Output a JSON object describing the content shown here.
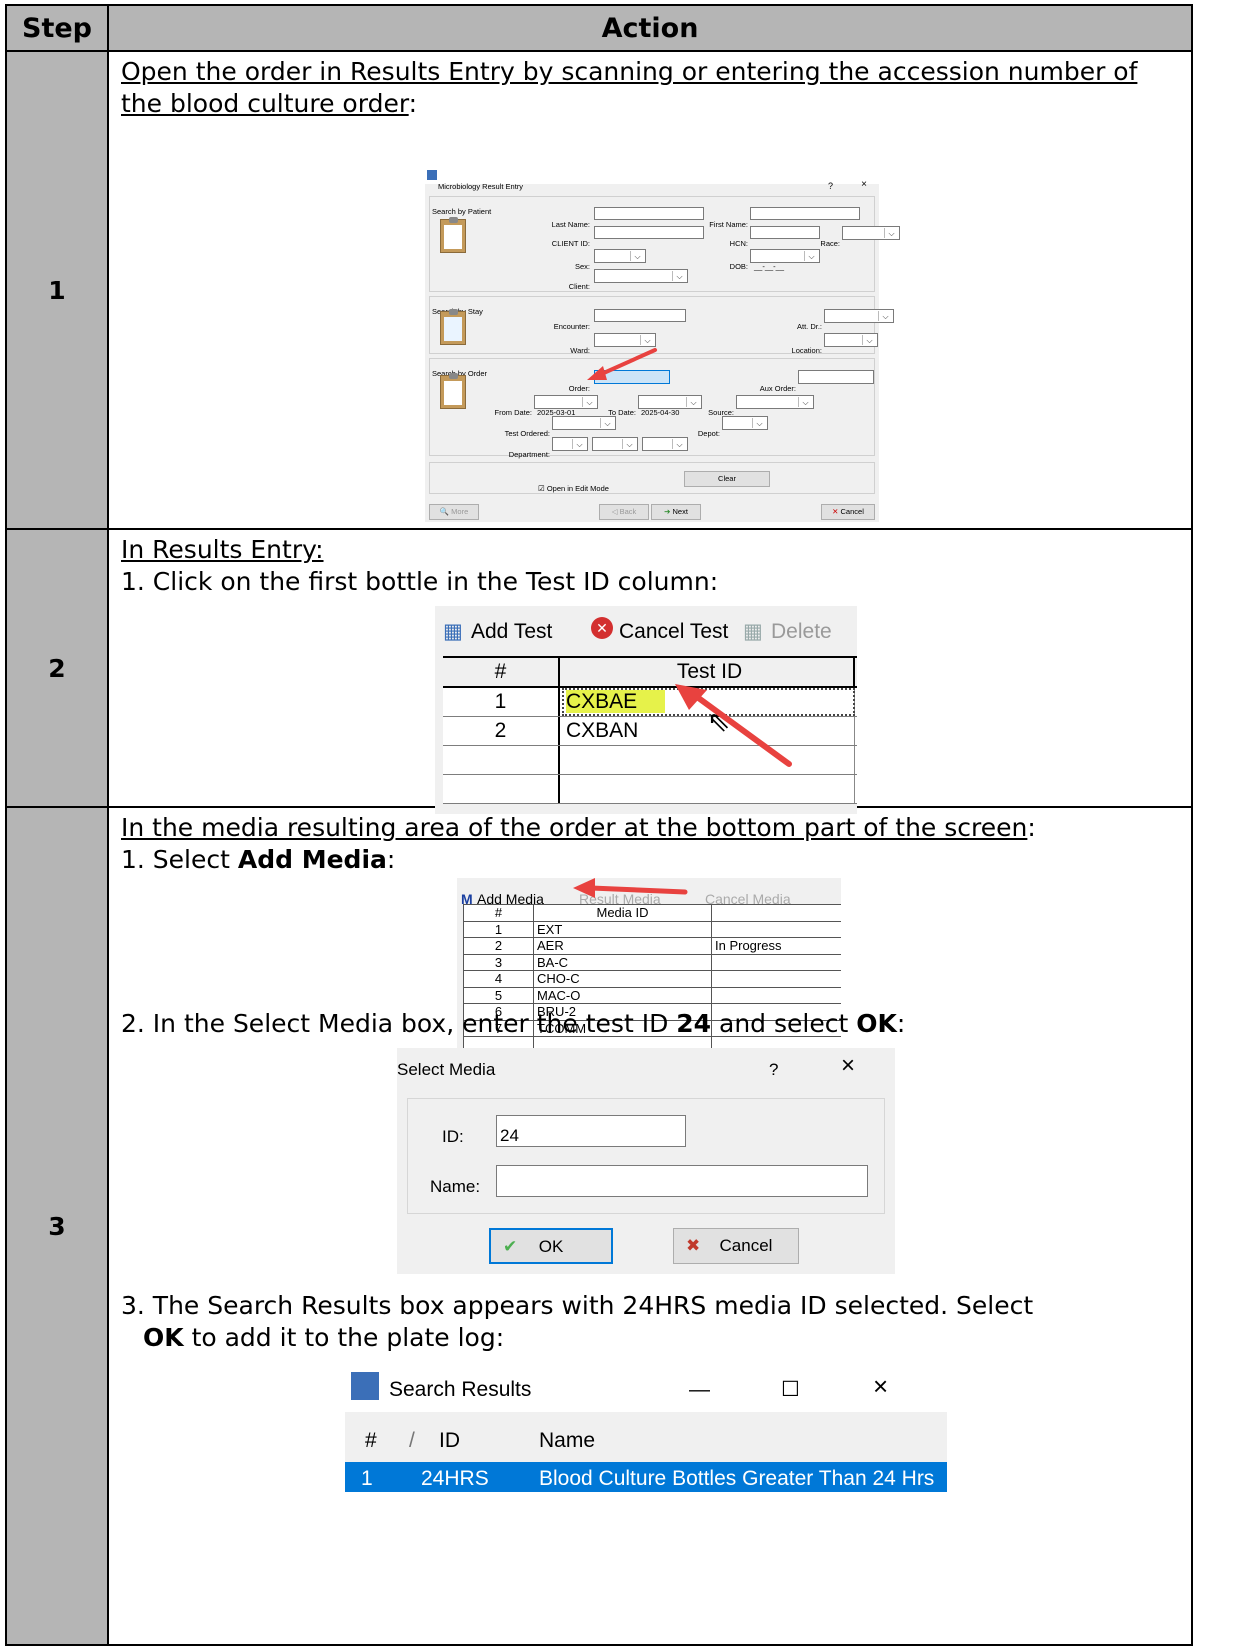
{
  "table": {
    "header_step": "Step",
    "header_action": "Action"
  },
  "step1": {
    "number": "1",
    "instruction": "Open the order in Results Entry by scanning or entering the accession number of the blood culture order",
    "instruction_suffix": ":",
    "dialog": {
      "title": "Microbiology Result Entry",
      "help": "?",
      "close": "×",
      "group_patient": "Search by Patient",
      "last_name": "Last Name:",
      "first_name": "First Name:",
      "client_id": "CLIENT ID:",
      "hcn": "HCN:",
      "race": "Race:",
      "sex": "Sex:",
      "dob": "DOB:",
      "dob_value": "__-__-__",
      "client": "Client:",
      "group_stay": "Search by Stay",
      "encounter": "Encounter:",
      "att_dr": "Att. Dr.:",
      "ward": "Ward:",
      "location": "Location:",
      "group_order": "Search by Order",
      "order": "Order:",
      "aux_order": "Aux Order:",
      "from_date": "From Date:",
      "from_date_value": "2025-03-01",
      "to_date": "To Date:",
      "to_date_value": "2025-04-30",
      "source": "Source:",
      "test_ordered": "Test Ordered:",
      "depot": "Depot:",
      "department": "Department:",
      "open_edit": "Open in Edit Mode",
      "clear": "Clear",
      "more": "More",
      "back": "Back",
      "next": "Next",
      "cancel": "Cancel"
    }
  },
  "step2": {
    "number": "2",
    "intro": "In Results Entry:",
    "item1": "1. Click on the first bottle in the Test ID column:",
    "toolbar": {
      "add_test": "Add Test",
      "cancel_test": "Cancel Test",
      "delete": "Delete"
    },
    "grid": {
      "col_num": "#",
      "col_test": "Test ID",
      "rows": [
        {
          "num": "1",
          "test": "CXBAE"
        },
        {
          "num": "2",
          "test": "CXBAN"
        }
      ]
    }
  },
  "step3": {
    "number": "3",
    "intro": "In the media resulting area of the order at the bottom part of the screen",
    "intro_suffix": ":",
    "item1_prefix": "1. Select ",
    "item1_bold": "Add Media",
    "item1_suffix": ":",
    "media_toolbar": {
      "add": "Add Media",
      "result": "Result Media",
      "cancel": "Cancel Media"
    },
    "media_grid": {
      "col_num": "#",
      "col_media": "Media ID",
      "rows": [
        {
          "num": "1",
          "id": "EXT",
          "status": ""
        },
        {
          "num": "2",
          "id": "AER",
          "status": "In Progress"
        },
        {
          "num": "3",
          "id": "BA-C",
          "status": ""
        },
        {
          "num": "4",
          "id": "CHO-C",
          "status": ""
        },
        {
          "num": "5",
          "id": "MAC-O",
          "status": ""
        },
        {
          "num": "6",
          "id": "BRU-2",
          "status": ""
        },
        {
          "num": "7",
          "id": "TCOMM",
          "status": ""
        }
      ]
    },
    "item2_prefix": "2. In the Select Media box, enter the test ID ",
    "item2_bold1": "24",
    "item2_mid": " and select ",
    "item2_bold2": "OK",
    "item2_suffix": ":",
    "select_media": {
      "title": "Select Media",
      "help": "?",
      "close": "×",
      "id_label": "ID:",
      "id_value": "24",
      "name_label": "Name:",
      "name_value": "",
      "ok": "OK",
      "cancel": "Cancel"
    },
    "item3_line1": "3. The Search Results box appears with 24HRS media ID selected. Select",
    "item3_bold": "OK",
    "item3_line2": " to add it to the plate log:",
    "search_results": {
      "title": "Search Results",
      "minimize": "—",
      "maximize": "☐",
      "close": "×",
      "col_num": "#",
      "col_sep": "/",
      "col_id": "ID",
      "col_name": "Name",
      "row_num": "1",
      "row_id": "24HRS",
      "row_name": "Blood Culture Bottles Greater Than 24 Hrs"
    }
  },
  "colors": {
    "step_bg": "#b5b5b5",
    "highlight_yellow": "#e6f24a",
    "select_blue": "#0078d7",
    "arrow_red": "#e8423f"
  }
}
